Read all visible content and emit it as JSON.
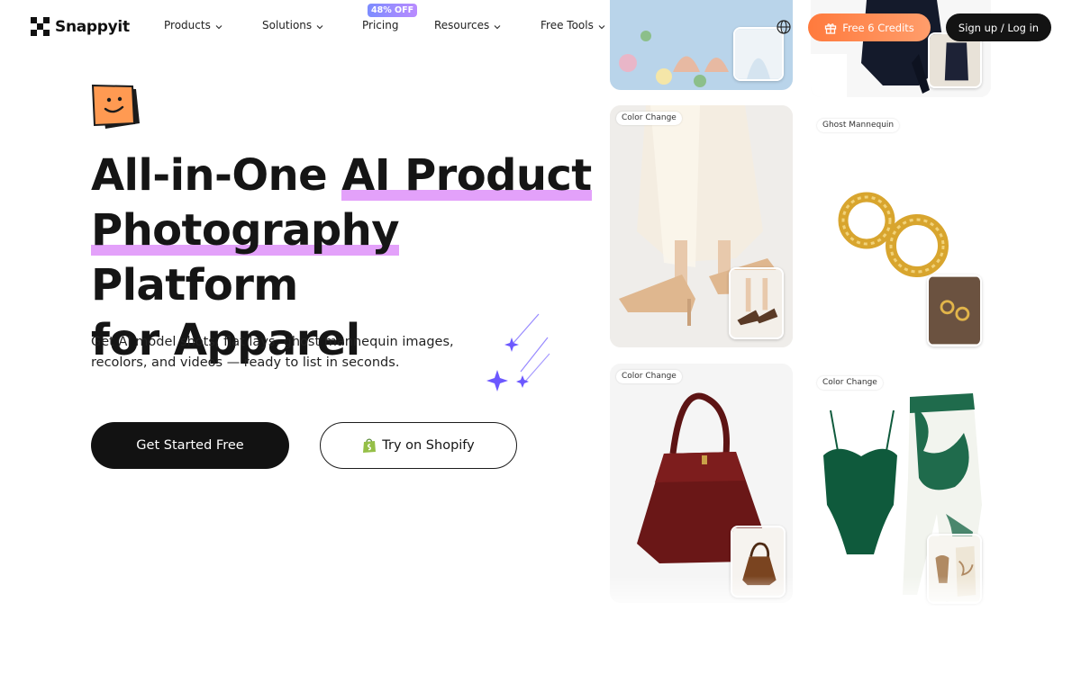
{
  "brand": {
    "name": "Snappyit",
    "accent": "#ff7a3d",
    "dark": "#131313",
    "highlight": "#e3a1fa"
  },
  "nav": {
    "items": [
      {
        "label": "Products",
        "has_menu": true
      },
      {
        "label": "Solutions",
        "has_menu": true
      },
      {
        "label": "Pricing",
        "has_menu": false
      },
      {
        "label": "Resources",
        "has_menu": true
      },
      {
        "label": "Free Tools",
        "has_menu": true
      }
    ],
    "pricing_badge": "48% OFF",
    "language_icon": "globe-icon",
    "credits_button": "Free 6 Credits",
    "credits_icon": "gift-icon",
    "auth_button": "Sign up / Log in"
  },
  "hero": {
    "headline_part1": "All-in-One ",
    "headline_highlight1": "AI Product",
    "headline_highlight2": "Photography",
    "headline_part2": " Platform",
    "headline_part3": "for Apparel",
    "subtitle": "Get AI model shots, flat lays, ghost mannequin images, recolors, and videos — ready to list in seconds.",
    "primary_cta": "Get Started Free",
    "secondary_cta": "Try on Shopify",
    "secondary_icon": "shopify-bag-icon"
  },
  "gallery": {
    "cards": [
      {
        "tag": "",
        "subject": "floral dress hands"
      },
      {
        "tag": "",
        "subject": "black tied top"
      },
      {
        "tag": "Color Change",
        "subject": "nude slingback heels"
      },
      {
        "tag": "Ghost Mannequin",
        "subject": "gold hoop earrings"
      },
      {
        "tag": "Color Change",
        "subject": "burgundy handbag"
      },
      {
        "tag": "Color Change",
        "subject": "green swimsuit and sarong"
      }
    ]
  }
}
